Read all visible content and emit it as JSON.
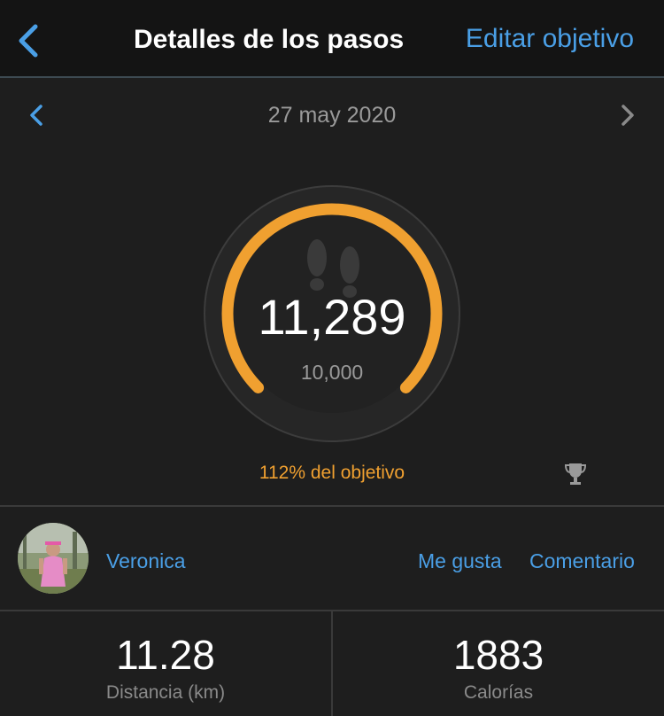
{
  "header": {
    "title": "Detalles de los pasos",
    "edit_goal_label": "Editar objetivo"
  },
  "date": {
    "label": "27 may 2020"
  },
  "steps": {
    "value": "11,289",
    "goal": "10,000",
    "percent_label": "112% del objetivo",
    "progress_fraction": 1.0
  },
  "social": {
    "user_name": "Veronica",
    "like_label": "Me gusta",
    "comment_label": "Comentario"
  },
  "stats": [
    {
      "value": "11.28",
      "label": "Distancia (km)"
    },
    {
      "value": "1883",
      "label": "Calorías"
    }
  ],
  "colors": {
    "accent": "#4a9fe6",
    "progress": "#f0a030",
    "background": "#1e1e1e"
  },
  "icons": {
    "back": "chevron-left-icon",
    "prev": "chevron-left-icon",
    "next": "chevron-right-icon",
    "footprints": "footprints-icon",
    "trophy": "trophy-icon"
  }
}
